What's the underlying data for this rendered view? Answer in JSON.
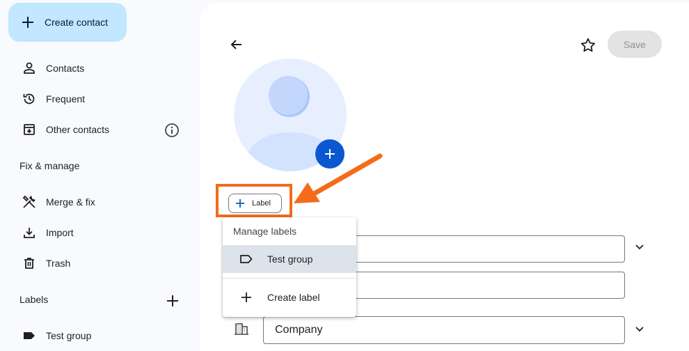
{
  "sidebar": {
    "create_label": "Create contact",
    "items": [
      {
        "label": "Contacts",
        "icon": "person-icon"
      },
      {
        "label": "Frequent",
        "icon": "history-icon"
      },
      {
        "label": "Other contacts",
        "icon": "archive-download-icon"
      }
    ],
    "fix_manage_title": "Fix & manage",
    "fix_items": [
      {
        "label": "Merge & fix",
        "icon": "tools-icon"
      },
      {
        "label": "Import",
        "icon": "download-icon"
      },
      {
        "label": "Trash",
        "icon": "trash-icon"
      }
    ],
    "labels_title": "Labels",
    "label_items": [
      {
        "label": "Test group",
        "icon": "label-icon"
      }
    ]
  },
  "toolbar": {
    "save_label": "Save"
  },
  "form": {
    "label_chip": "Label",
    "company_placeholder": "Company"
  },
  "label_menu": {
    "header": "Manage labels",
    "items": [
      {
        "label": "Test group",
        "selected": true
      },
      {
        "label": "Create label",
        "selected": false
      }
    ]
  },
  "colors": {
    "accent": "#0b57d0",
    "create_button": "#c2e7ff",
    "annotation": "#f46b1a"
  }
}
